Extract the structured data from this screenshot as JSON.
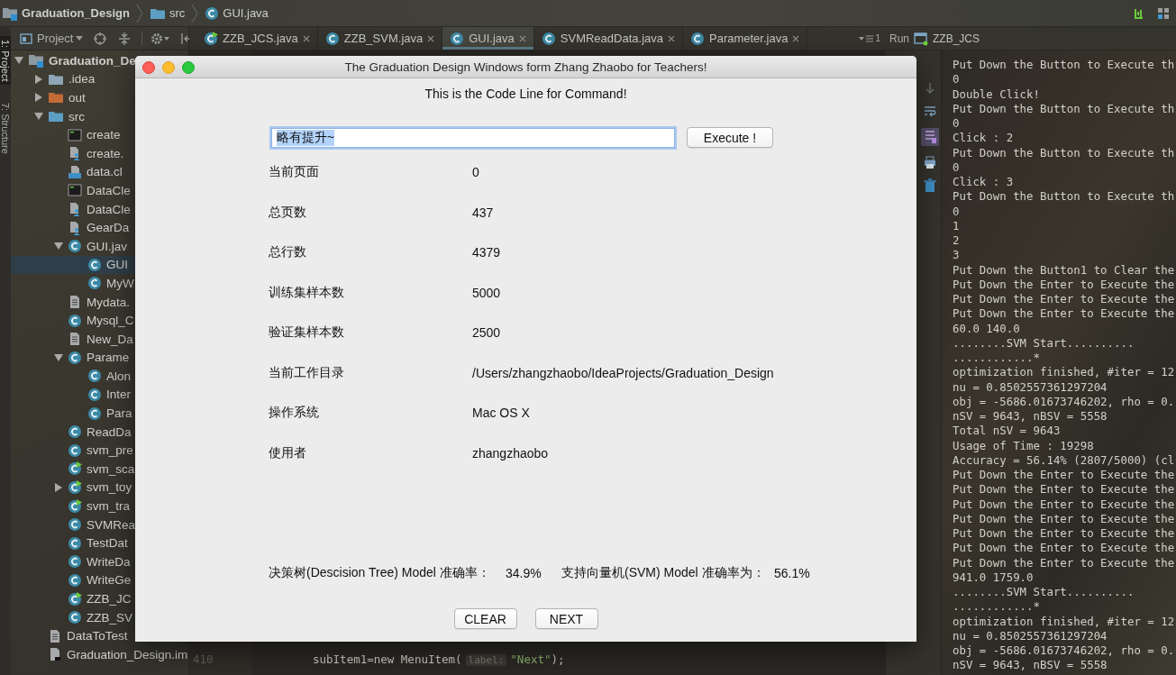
{
  "breadcrumb": [
    "Graduation_Design",
    "src",
    "GUI.java"
  ],
  "side_tabs": [
    "1: Project",
    "7: Structure"
  ],
  "project_panel": {
    "view": "Project",
    "tree": [
      {
        "label": "Graduation_De",
        "kind": "module",
        "expanded": true,
        "selected": false,
        "children": [
          {
            "label": ".idea",
            "kind": "folder",
            "expanded": false,
            "selected": false
          },
          {
            "label": "out",
            "kind": "excluded",
            "expanded": false,
            "selected": false
          },
          {
            "label": "src",
            "kind": "source",
            "expanded": true,
            "selected": false,
            "children": [
              {
                "label": "create",
                "kind": "console",
                "selected": false
              },
              {
                "label": "create.",
                "kind": "person",
                "selected": false
              },
              {
                "label": "data.cl",
                "kind": "binary",
                "selected": false
              },
              {
                "label": "DataCle",
                "kind": "console",
                "selected": false
              },
              {
                "label": "DataCle",
                "kind": "person",
                "selected": false
              },
              {
                "label": "GearDa",
                "kind": "person",
                "selected": false
              },
              {
                "label": "GUI.jav",
                "kind": "class",
                "expanded": true,
                "selected": false,
                "children": [
                  {
                    "label": "GUI",
                    "kind": "class",
                    "selected": true
                  },
                  {
                    "label": "MyW",
                    "kind": "class",
                    "selected": false
                  }
                ]
              },
              {
                "label": "Mydata.",
                "kind": "text",
                "selected": false
              },
              {
                "label": "Mysql_C",
                "kind": "class",
                "selected": false
              },
              {
                "label": "New_Da",
                "kind": "text",
                "selected": false
              },
              {
                "label": "Parame",
                "kind": "class",
                "expanded": true,
                "selected": false,
                "children": [
                  {
                    "label": "Alon",
                    "kind": "class",
                    "selected": false
                  },
                  {
                    "label": "Inter",
                    "kind": "class",
                    "selected": false
                  },
                  {
                    "label": "Para",
                    "kind": "class",
                    "selected": false
                  }
                ]
              },
              {
                "label": "ReadDa",
                "kind": "class",
                "selected": false
              },
              {
                "label": "svm_pre",
                "kind": "class",
                "selected": false
              },
              {
                "label": "svm_sca",
                "kind": "runnable",
                "selected": false
              },
              {
                "label": "svm_toy",
                "kind": "runnable",
                "expanded": false,
                "selected": false
              },
              {
                "label": "svm_tra",
                "kind": "runnable",
                "selected": false
              },
              {
                "label": "SVMRea",
                "kind": "class",
                "selected": false
              },
              {
                "label": "TestDat",
                "kind": "class",
                "selected": false
              },
              {
                "label": "WriteDa",
                "kind": "class",
                "selected": false
              },
              {
                "label": "WriteGe",
                "kind": "class",
                "selected": false
              },
              {
                "label": "ZZB_JC",
                "kind": "runnable",
                "selected": false
              },
              {
                "label": "ZZB_SV",
                "kind": "class",
                "selected": false
              }
            ]
          },
          {
            "label": "DataToTest",
            "kind": "text",
            "selected": false
          },
          {
            "label": "Graduation_Design.im",
            "kind": "iml",
            "selected": false
          }
        ]
      }
    ]
  },
  "editor_tabs": [
    {
      "label": "ZZB_JCS.java",
      "kind": "runnable",
      "selected": false
    },
    {
      "label": "ZZB_SVM.java",
      "kind": "class",
      "selected": false
    },
    {
      "label": "GUI.java",
      "kind": "class",
      "selected": true
    },
    {
      "label": "SVMReadData.java",
      "kind": "class",
      "selected": false
    },
    {
      "label": "Parameter.java",
      "kind": "class",
      "selected": false
    }
  ],
  "tab_overflow_count": "1",
  "code_lines": [
    {
      "number": "410",
      "code": "subItem1=new MenuItem(",
      "hint": "label:",
      "string": "\"Next\"",
      "end": ");"
    }
  ],
  "run_panel": {
    "title": "Run",
    "config": "ZZB_JCS",
    "console": [
      "Put Down the Button to Execute th",
      "0",
      "Double Click!",
      "Put Down the Button to Execute th",
      "0",
      "Click : 2",
      "Put Down the Button to Execute th",
      "0",
      "Click : 3",
      "Put Down the Button to Execute th",
      "0",
      "1",
      "2",
      "3",
      "Put Down the Button1 to Clear the",
      "Put Down the Enter to Execute the",
      "Put Down the Enter to Execute the",
      "Put Down the Enter to Execute the",
      "60.0 140.0",
      "........SVM Start..........",
      "............*",
      "optimization finished, #iter = 12",
      "nu = 0.8502557361297204",
      "obj = -5686.01673746202, rho = 0.",
      "nSV = 9643, nBSV = 5558",
      "Total nSV = 9643",
      "Usage of Time : 19298",
      "Accuracy = 56.14% (2807/5000) (cl",
      "Put Down the Enter to Execute the",
      "Put Down the Enter to Execute the",
      "Put Down the Enter to Execute the",
      "Put Down the Enter to Execute the",
      "Put Down the Enter to Execute the",
      "Put Down the Enter to Execute the",
      "Put Down the Enter to Execute the",
      "941.0 1759.0",
      "........SVM Start..........",
      "............*",
      "optimization finished, #iter = 12",
      "nu = 0.8502557361297204",
      "obj = -5686.01673746202, rho = 0.",
      "nSV = 9643, nBSV = 5558"
    ]
  },
  "dialog": {
    "title": "The Graduation Design Windows form Zhang Zhaobo for Teachers!",
    "heading": "This is the Code Line for Command!",
    "command": {
      "value": "略有提升~",
      "text_selected": true
    },
    "execute_button": "Execute !",
    "info_rows": [
      {
        "label": "当前页面",
        "value": "0"
      },
      {
        "label": "总页数",
        "value": "437"
      },
      {
        "label": "总行数",
        "value": "4379"
      },
      {
        "label": "训练集样本数",
        "value": "5000"
      },
      {
        "label": "验证集样本数",
        "value": "2500"
      },
      {
        "label": "当前工作目录",
        "value": "/Users/zhangzhaobo/IdeaProjects/Graduation_Design"
      },
      {
        "label": "操作系统",
        "value": "Mac OS X"
      },
      {
        "label": "使用者",
        "value": "zhangzhaobo"
      }
    ],
    "accuracy": [
      {
        "label": "决策树(Descision Tree) Model 准确率：",
        "value": "34.9%"
      },
      {
        "label": "支持向量机(SVM) Model 准确率为：",
        "value": "56.1%"
      }
    ],
    "buttons": [
      "CLEAR",
      "NEXT"
    ]
  }
}
